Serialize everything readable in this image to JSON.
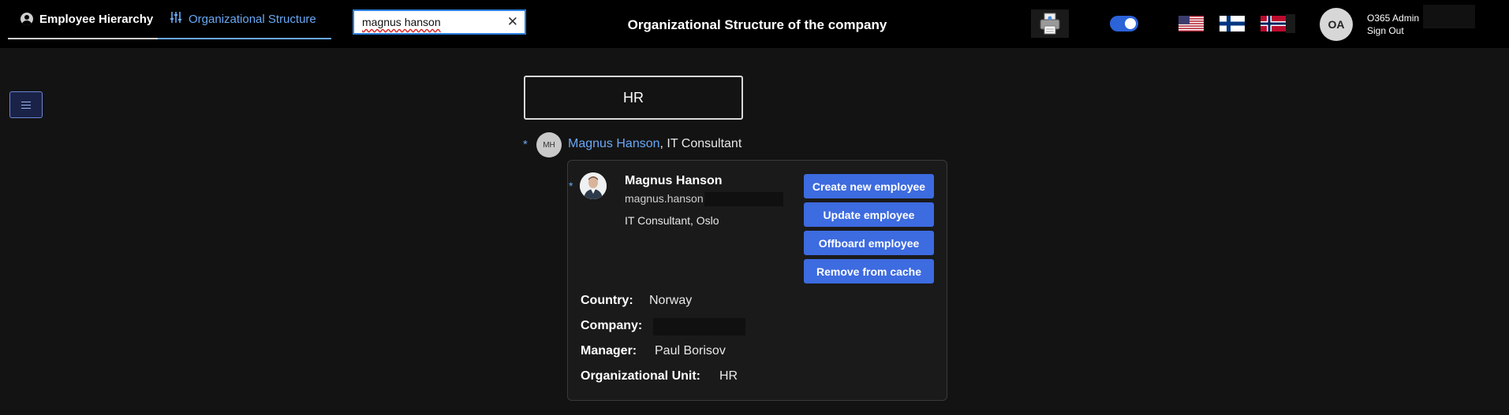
{
  "header": {
    "tabs": [
      {
        "label": "Employee Hierarchy"
      },
      {
        "label": "Organizational Structure"
      }
    ],
    "search": {
      "value": "magnus hanson"
    },
    "title": "Organizational Structure of the company",
    "user": {
      "initials": "OA",
      "name": "O365 Admin",
      "signout": "Sign Out"
    },
    "toggle_state": "on",
    "flags": [
      "us-flag",
      "finland-flag",
      "norway-flag"
    ]
  },
  "org": {
    "unit_box": "HR",
    "row": {
      "bullet": "*",
      "initials": "MH",
      "name": "Magnus Hanson",
      "suffix": ", IT Consultant"
    }
  },
  "card": {
    "bullet": "*",
    "name": "Magnus Hanson",
    "email_visible": "magnus.hanson",
    "title_location": "IT Consultant, Oslo",
    "buttons": {
      "create": "Create new employee",
      "update": "Update employee",
      "offboard": "Offboard employee",
      "remove": "Remove from cache"
    },
    "details": {
      "country_label": "Country:",
      "country": "Norway",
      "company_label": "Company:",
      "company": "",
      "manager_label": "Manager:",
      "manager": "Paul Borisov",
      "ou_label": "Organizational Unit:",
      "ou": "HR"
    }
  },
  "colors": {
    "accent": "#69a8f5",
    "button": "#3d6be0",
    "background": "#131313"
  }
}
